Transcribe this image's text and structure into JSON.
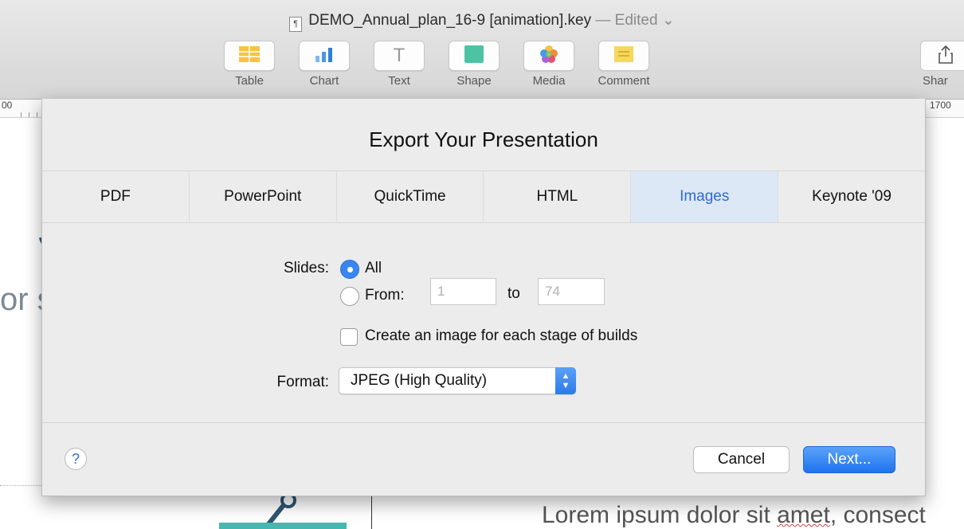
{
  "window": {
    "title": "DEMO_Annual_plan_16-9 [animation].key",
    "status": "— Edited",
    "doc_icon": "keynote-document-icon"
  },
  "toolbar": {
    "buttons": [
      {
        "label": "Table",
        "icon": "table-icon"
      },
      {
        "label": "Chart",
        "icon": "chart-icon"
      },
      {
        "label": "Text",
        "icon": "text-icon"
      },
      {
        "label": "Shape",
        "icon": "shape-icon"
      },
      {
        "label": "Media",
        "icon": "media-icon"
      },
      {
        "label": "Comment",
        "icon": "comment-icon"
      }
    ],
    "share_label": "Shar"
  },
  "ruler": {
    "left_label": "00",
    "right_label": "1700"
  },
  "slide_background": {
    "big_letter": "S",
    "side_text": "or s",
    "lorem": "Lorem ipsum dolor sit ",
    "lorem_spell": "amet",
    "lorem_tail": ", consect"
  },
  "dialog": {
    "title": "Export Your Presentation",
    "tabs": [
      {
        "label": "PDF",
        "active": false
      },
      {
        "label": "PowerPoint",
        "active": false
      },
      {
        "label": "QuickTime",
        "active": false
      },
      {
        "label": "HTML",
        "active": false
      },
      {
        "label": "Images",
        "active": true
      },
      {
        "label": "Keynote '09",
        "active": false
      }
    ],
    "slides_label": "Slides:",
    "all_label": "All",
    "from_label": "From:",
    "from_value": "1",
    "to_label": "to",
    "to_value": "74",
    "builds_label": "Create an image for each stage of builds",
    "format_label": "Format:",
    "format_value": "JPEG (High Quality)",
    "help_label": "?",
    "cancel_label": "Cancel",
    "next_label": "Next..."
  },
  "colors": {
    "accent": "#3a86f0",
    "active_tab_bg": "#dde8f7",
    "active_tab_text": "#2e6bd6"
  }
}
